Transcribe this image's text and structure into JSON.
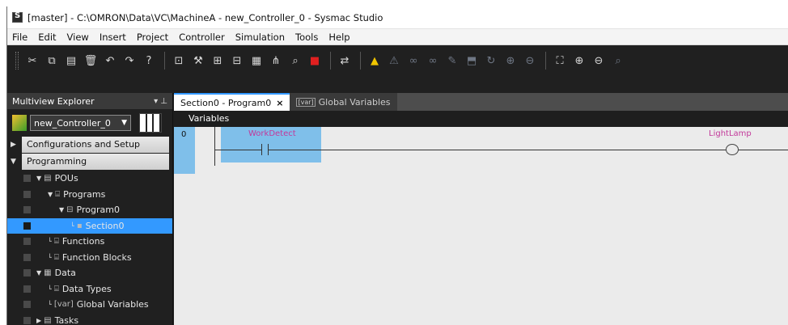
{
  "window": {
    "title": "[master] - C:\\OMRON\\Data\\VC\\MachineA - new_Controller_0 - Sysmac Studio"
  },
  "menu": [
    "File",
    "Edit",
    "View",
    "Insert",
    "Project",
    "Controller",
    "Simulation",
    "Tools",
    "Help"
  ],
  "toolbar": {
    "buttons": [
      {
        "name": "cut-icon",
        "glyph": "✂",
        "tone": ""
      },
      {
        "name": "copy-icon",
        "glyph": "⧉",
        "tone": ""
      },
      {
        "name": "paste-icon",
        "glyph": "▤",
        "tone": ""
      },
      {
        "name": "delete-icon",
        "glyph": "🗑",
        "tone": ""
      },
      {
        "name": "undo-icon",
        "glyph": "↶",
        "tone": ""
      },
      {
        "name": "redo-icon",
        "glyph": "↷",
        "tone": ""
      },
      {
        "name": "help-icon",
        "glyph": "?",
        "tone": ""
      },
      {
        "sep": true
      },
      {
        "name": "build-icon",
        "glyph": "⊡",
        "tone": ""
      },
      {
        "name": "wrench-icon",
        "glyph": "⚒",
        "tone": ""
      },
      {
        "name": "compare-icon",
        "glyph": "⊞",
        "tone": ""
      },
      {
        "name": "cross-reference-icon",
        "glyph": "⊟",
        "tone": ""
      },
      {
        "name": "variable-table-icon",
        "glyph": "▦",
        "tone": ""
      },
      {
        "name": "network-icon",
        "glyph": "⋔",
        "tone": ""
      },
      {
        "name": "find-icon",
        "glyph": "⌕",
        "tone": ""
      },
      {
        "name": "stop-icon",
        "glyph": "■",
        "tone": "red"
      },
      {
        "sep": true
      },
      {
        "name": "transfer-icon",
        "glyph": "⇄",
        "tone": ""
      },
      {
        "sep": true
      },
      {
        "name": "warning-icon",
        "glyph": "▲",
        "tone": "yellow"
      },
      {
        "name": "force-icon",
        "glyph": "⚠",
        "tone": "dim"
      },
      {
        "name": "set-icon",
        "glyph": "∞",
        "tone": "dim"
      },
      {
        "name": "reset-icon",
        "glyph": "∞",
        "tone": "dim"
      },
      {
        "name": "online-edit-icon",
        "glyph": "✎",
        "tone": "dim"
      },
      {
        "name": "monitor-icon",
        "glyph": "⬒",
        "tone": "dim"
      },
      {
        "name": "refresh-icon",
        "glyph": "↻",
        "tone": "dim"
      },
      {
        "name": "io-map-icon",
        "glyph": "⊕",
        "tone": "dim"
      },
      {
        "name": "axis-icon",
        "glyph": "⊖",
        "tone": "dim"
      },
      {
        "sep": true
      },
      {
        "name": "zoom-fit-icon",
        "glyph": "⛶",
        "tone": ""
      },
      {
        "name": "zoom-in-icon",
        "glyph": "⊕",
        "tone": ""
      },
      {
        "name": "zoom-out-icon",
        "glyph": "⊖",
        "tone": ""
      },
      {
        "name": "zoom-100-icon",
        "glyph": "⌕",
        "tone": "dim"
      }
    ]
  },
  "explorer": {
    "title": "Multiview Explorer",
    "pin": "▾ ⊥",
    "controller": "new_Controller_0",
    "sections": {
      "config": "Configurations and Setup",
      "programming": "Programming"
    },
    "tree": [
      {
        "label": "POUs",
        "indent": 1,
        "twisty": "▼",
        "icon": "▤",
        "name": "tree-item-pous",
        "selected": false
      },
      {
        "label": "Programs",
        "indent": 2,
        "twisty": "▼",
        "icon": "⌸",
        "name": "tree-item-programs",
        "selected": false
      },
      {
        "label": "Program0",
        "indent": 3,
        "twisty": "▼",
        "icon": "⊟",
        "name": "tree-item-program0",
        "selected": false
      },
      {
        "label": "Section0",
        "indent": 4,
        "twisty": "└",
        "icon": "▪",
        "name": "tree-item-section0",
        "selected": true
      },
      {
        "label": "Functions",
        "indent": 2,
        "twisty": "└",
        "icon": "⌸",
        "name": "tree-item-functions",
        "selected": false
      },
      {
        "label": "Function Blocks",
        "indent": 2,
        "twisty": "└",
        "icon": "⌸",
        "name": "tree-item-function-blocks",
        "selected": false
      },
      {
        "label": "Data",
        "indent": 1,
        "twisty": "▼",
        "icon": "▦",
        "name": "tree-item-data",
        "selected": false
      },
      {
        "label": "Data Types",
        "indent": 2,
        "twisty": "└",
        "icon": "⌸",
        "name": "tree-item-data-types",
        "selected": false
      },
      {
        "label": "Global Variables",
        "indent": 2,
        "twisty": "└",
        "icon": "[var]",
        "name": "tree-item-global-variables",
        "selected": false
      },
      {
        "label": "Tasks",
        "indent": 1,
        "twisty": "▶",
        "icon": "▤",
        "name": "tree-item-tasks",
        "selected": false
      }
    ]
  },
  "tabs": {
    "active": "Section0 - Program0",
    "close": "×",
    "inactive_icon": "[var]",
    "inactive": "Global Variables"
  },
  "variables_label": "Variables",
  "ladder": {
    "rung_number": "0",
    "contact_variable": "WorkDetect",
    "coil_variable": "LightLamp"
  }
}
